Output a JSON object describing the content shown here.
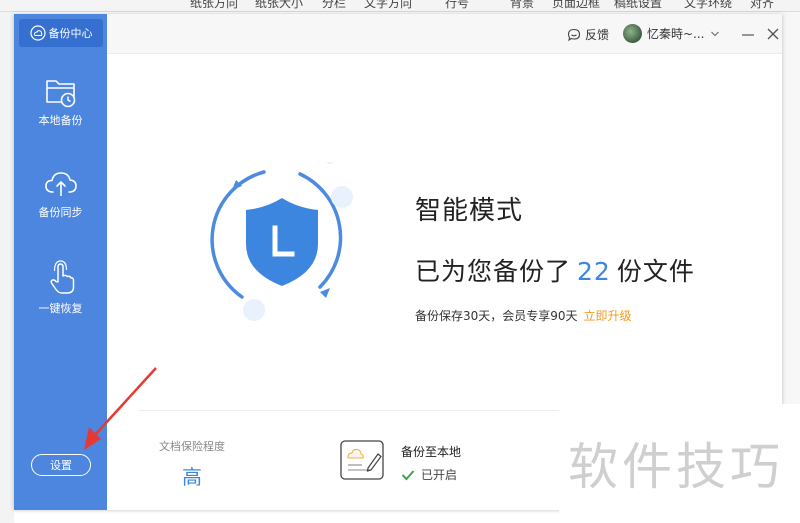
{
  "background_toolbar": {
    "items": [
      "纸张方向",
      "纸张大小",
      "分栏",
      "文字方向",
      "行号",
      "背景",
      "页面边框",
      "稿纸设置",
      "文字环绕",
      "对齐"
    ]
  },
  "sidebar": {
    "brand_label": "备份中心",
    "items": [
      {
        "label": "本地备份",
        "icon": "folder-clock-icon"
      },
      {
        "label": "备份同步",
        "icon": "cloud-upload-icon"
      },
      {
        "label": "一键恢复",
        "icon": "hand-pointer-icon"
      }
    ],
    "settings_label": "设置"
  },
  "titlebar": {
    "feedback_label": "反馈",
    "user_name": "忆秦時~...",
    "minimize_icon": "minimize-icon",
    "close_icon": "close-icon"
  },
  "main": {
    "mode_title": "智能模式",
    "backup_prefix": "已为您备份了",
    "backup_count": "22",
    "backup_suffix": "份文件",
    "retention_text": "备份保存30天，会员专享90天",
    "upgrade_link": "立即升级",
    "protect_label": "文档保险程度",
    "protect_value": "高",
    "local_backup_title": "备份至本地",
    "local_backup_status": "已开启"
  },
  "watermark": "软件技巧",
  "colors": {
    "sidebar": "#4d86df",
    "brand": "#3570d1",
    "accent": "#3d86e0",
    "upgrade": "#f39a1e",
    "arrow": "#e53935",
    "check": "#3aa845"
  }
}
